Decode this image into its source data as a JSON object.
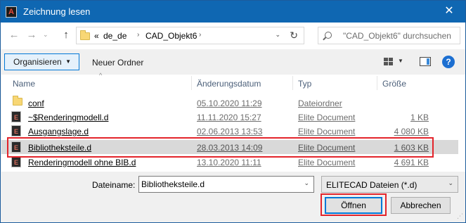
{
  "window": {
    "title": "Zeichnung lesen",
    "close_glyph": "✕",
    "app_icon": "A"
  },
  "nav": {
    "back_glyph": "←",
    "forward_glyph": "→",
    "recent_glyph": "⌄",
    "up_glyph": "↑",
    "path_overflow": "«",
    "path": [
      "de_de",
      "CAD_Objekt6"
    ],
    "path_separator": "›",
    "dropdown_glyph": "⌄",
    "refresh_glyph": "↻",
    "search_placeholder": "\"CAD_Objekt6\" durchsuchen"
  },
  "toolbar": {
    "organize_label": "Organisieren",
    "organize_caret": "▼",
    "new_folder_label": "Neuer Ordner",
    "view_caret": "▼",
    "help_glyph": "?"
  },
  "columns": {
    "name": "Name",
    "date": "Änderungsdatum",
    "type": "Typ",
    "size": "Größe",
    "sort_glyph": "^"
  },
  "files": [
    {
      "name": "conf",
      "date": "05.10.2020 11:29",
      "type": "Dateiordner",
      "size": "",
      "icon": "folder-icon"
    },
    {
      "name": "~$Renderingmodell.d",
      "date": "11.11.2020 15:27",
      "type": "Elite Document",
      "size": "1 KB",
      "icon": "elite-document-icon"
    },
    {
      "name": "Ausgangslage.d",
      "date": "02.06.2013 13:53",
      "type": "Elite Document",
      "size": "4 080 KB",
      "icon": "elite-document-icon"
    },
    {
      "name": "Bibliotheksteile.d",
      "date": "28.03.2013 14:09",
      "type": "Elite Document",
      "size": "1 603 KB",
      "icon": "elite-document-icon",
      "selected": true
    },
    {
      "name": "Renderingmodell ohne BIB.d",
      "date": "13.10.2020 11:11",
      "type": "Elite Document",
      "size": "4 691 KB",
      "icon": "elite-document-icon"
    }
  ],
  "elite_icon_glyph": "E",
  "bottom": {
    "filename_label": "Dateiname:",
    "filename_value": "Bibliotheksteile.d",
    "filename_dropdown": "⌄",
    "filter_value": "ELITECAD Dateien (*.d)",
    "filter_dropdown": "⌄",
    "open_label": "Öffnen",
    "cancel_label": "Abbrechen",
    "grip_glyph": "⋰"
  },
  "colors": {
    "titlebar": "#0f67b2",
    "highlight_box": "#e3242b",
    "selection": "#d9d9d9",
    "accent": "#0078d7"
  }
}
